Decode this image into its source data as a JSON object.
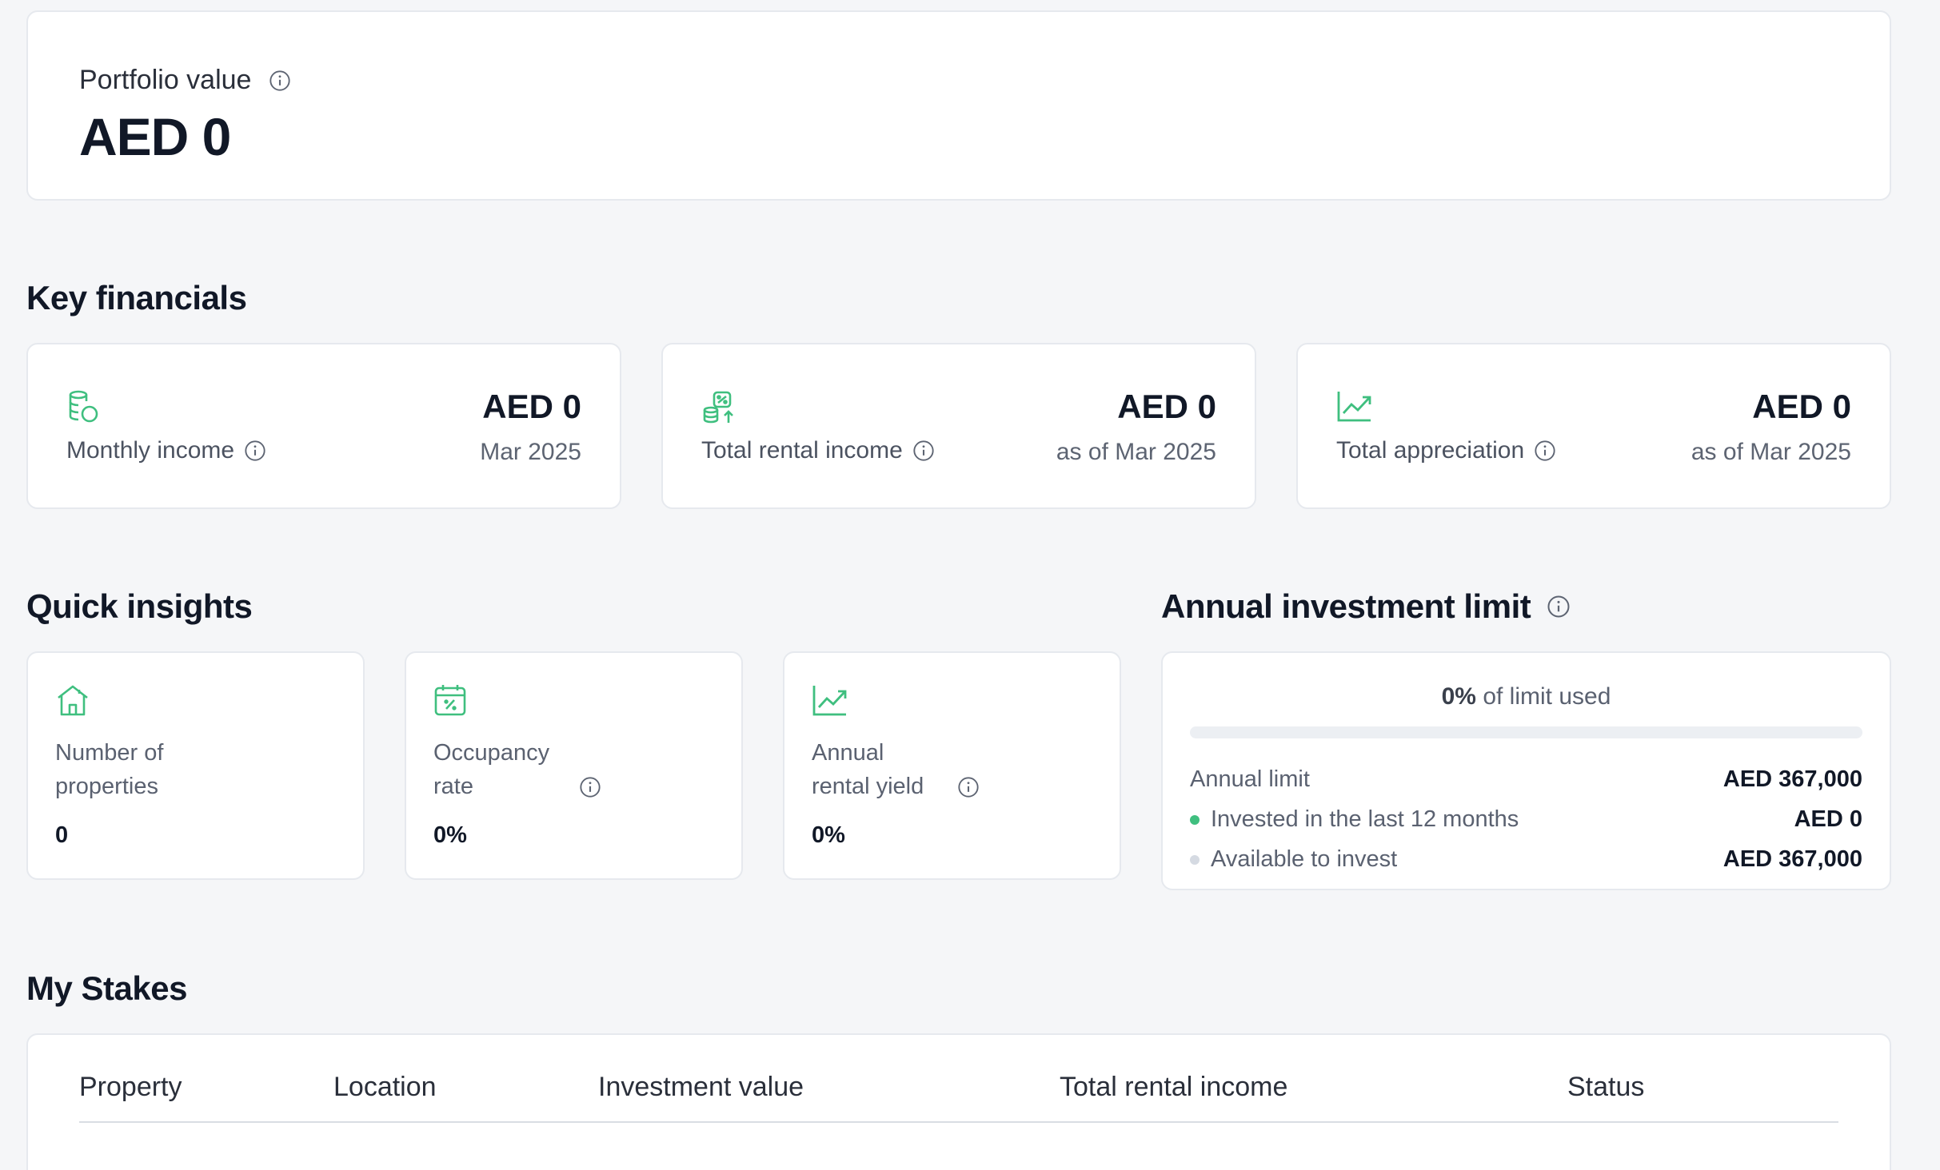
{
  "portfolio": {
    "label": "Portfolio value",
    "value": "AED 0"
  },
  "key_financials": {
    "title": "Key financials",
    "cards": [
      {
        "icon": "coins-stack-icon",
        "label": "Monthly income",
        "value": "AED 0",
        "sub": "Mar 2025"
      },
      {
        "icon": "rental-income-icon",
        "label": "Total rental income",
        "value": "AED 0",
        "sub": "as of Mar 2025"
      },
      {
        "icon": "trend-chart-icon",
        "label": "Total appreciation",
        "value": "AED 0",
        "sub": "as of Mar 2025"
      }
    ]
  },
  "quick_insights": {
    "title": "Quick insights",
    "cards": [
      {
        "icon": "house-icon",
        "label": "Number of properties",
        "value": "0"
      },
      {
        "icon": "calendar-percent-icon",
        "label": "Occupancy rate",
        "value": "0%"
      },
      {
        "icon": "trend-chart-icon",
        "label": "Annual rental yield",
        "value": "0%"
      }
    ]
  },
  "annual_limit": {
    "title": "Annual investment limit",
    "used_percent_text": "0%",
    "used_suffix": "of limit used",
    "used_fraction": 0,
    "rows": {
      "limit_label": "Annual limit",
      "limit_value": "AED 367,000",
      "invested_label": "Invested in the last 12 months",
      "invested_value": "AED 0",
      "available_label": "Available to invest",
      "available_value": "AED 367,000"
    }
  },
  "stakes": {
    "title": "My Stakes",
    "columns": [
      "Property",
      "Location",
      "Investment value",
      "Total rental income",
      "Status"
    ]
  },
  "colors": {
    "accent": "#3fbf7f",
    "muted_dot": "#d5dae2"
  }
}
